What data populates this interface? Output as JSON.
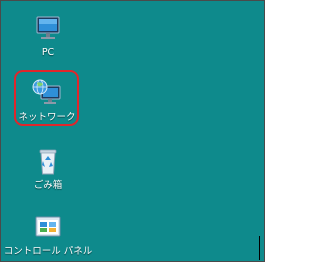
{
  "desktop": {
    "background_color": "#0e8a8c",
    "icons": [
      {
        "label": "PC",
        "icon": "pc-monitor-icon"
      },
      {
        "label": "ネットワーク",
        "icon": "network-globe-icon"
      },
      {
        "label": "ごみ箱",
        "icon": "recycle-bin-icon"
      },
      {
        "label": "コントロール パネル",
        "icon": "control-panel-icon"
      }
    ],
    "highlight_color": "#e0262b"
  }
}
